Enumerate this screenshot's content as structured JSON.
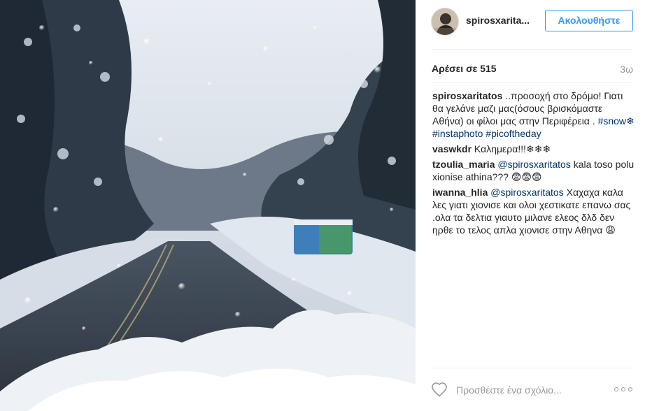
{
  "post": {
    "username": "spirosxarita...",
    "follow_label": "Ακολουθήστε",
    "likes_label": "Αρέσει σε 515",
    "age": "3ω"
  },
  "comments": [
    {
      "user": "spirosxaritatos",
      "text": " ..προσοχή στο δρόμο! Γιατι θα γελάνε μαζι μας(όσους βρισκόμαστε Αθήνα) οι φίλοι μας στην Περιφέρεια . ",
      "tags": [
        "#snow❄",
        "#instaphoto",
        "#picoftheday"
      ]
    },
    {
      "user": "vaswkdr",
      "text": " Καλημερα!!!❄❄❄"
    },
    {
      "user": "tzoulia_maria",
      "mention": "@spirosxaritatos",
      "text": " kala toso polu xionise athina??? 😨😨😨"
    },
    {
      "user": "iwanna_hlia",
      "mention": "@spirosxaritatos",
      "text": " Χαχαχα καλα λες γιατι χιονισε και ολοι χεστικατε επανω σας .ολα τα δελτια γιαυτο μιλανε ελεος δλδ δεν ηρθε το τελος απλα χιονισε στην Αθηνα 😩"
    }
  ],
  "footer": {
    "comment_placeholder": "Προσθέστε ένα σχόλιο..."
  },
  "icons": {
    "like": "heart-icon",
    "more": "more-options-icon"
  },
  "colors": {
    "accent": "#3897f0",
    "link": "#003569",
    "muted": "#999999"
  }
}
